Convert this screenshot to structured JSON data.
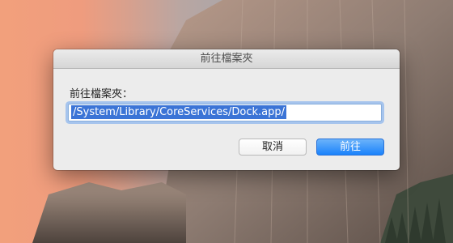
{
  "dialog": {
    "title": "前往檔案夾",
    "prompt": "前往檔案夾：",
    "path_value": "/System/Library/CoreServices/Dock.app/",
    "cancel_label": "取消",
    "go_label": "前往"
  },
  "colors": {
    "accent": "#1a82fb",
    "selection": "#3b74d6"
  }
}
